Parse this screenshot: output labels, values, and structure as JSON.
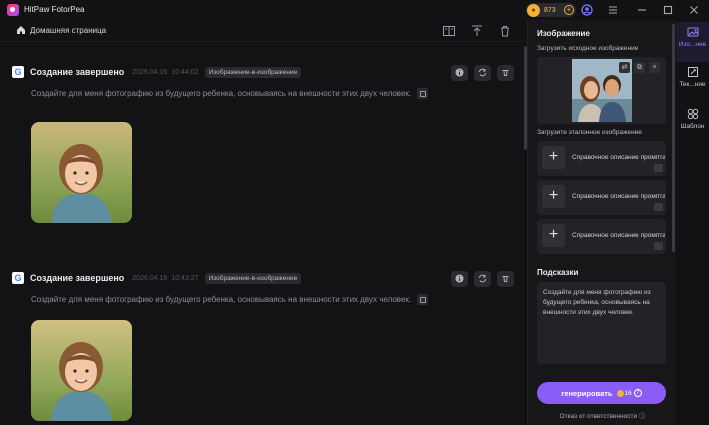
{
  "app": {
    "title": "HitPaw FotorPea"
  },
  "titlebar": {
    "coins": "873"
  },
  "header": {
    "breadcrumb": "Домашняя страница"
  },
  "results": [
    {
      "title": "Создание завершено",
      "date": "2026.04.16",
      "time": "10:44:02",
      "tag": "Изображение-в-изображение",
      "prompt": "Создайте для меня фотографию из будущего ребенка, основываясь на внешности этих двух человек."
    },
    {
      "title": "Создание завершено",
      "date": "2026.04.16",
      "time": "10:43:27",
      "tag": "Изображение-в-изображение",
      "prompt": "Создайте для меня фотографию из будущего ребенка, основываясь на внешности этих двух человек."
    }
  ],
  "panel": {
    "section_title": "Изображение",
    "upload_label": "Загрузить исходное изображение",
    "reference_label": "Загрузите эталонное изображение",
    "reference_items": [
      {
        "label": "Справочное описание промпта"
      },
      {
        "label": "Справочное описание промпта"
      },
      {
        "label": "Справочное описание промпта"
      }
    ],
    "hints_title": "Подсказки",
    "hint_text": "Создайте для меня фотографию из будущего ребенка, основываясь на внешности этих двух человек.",
    "generate_label": "генерировать",
    "generate_cost": "16",
    "disclaimer": "Отказ от ответственности"
  },
  "sidenav": {
    "items": [
      {
        "label": "Изо...ние",
        "icon": "image-icon",
        "active": true
      },
      {
        "label": "Тек...ние",
        "icon": "text-edit-icon",
        "active": false
      },
      {
        "label": "Шаблон",
        "icon": "template-icon",
        "active": false
      }
    ]
  },
  "colors": {
    "accent": "#8a5cf6",
    "coin": "#f2b233",
    "background": "#0e0e10"
  }
}
